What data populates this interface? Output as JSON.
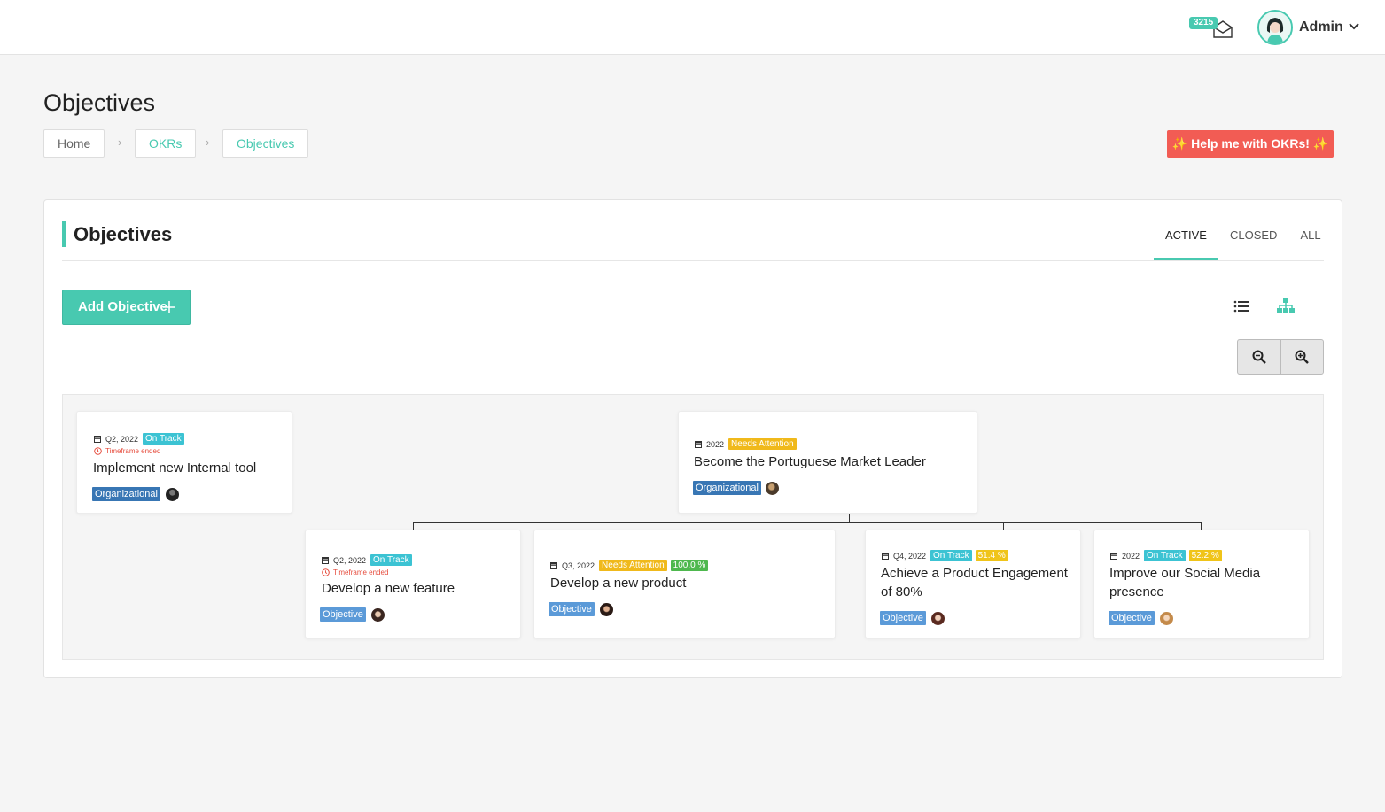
{
  "topbar": {
    "mail_count": "3215",
    "user_name": "Admin"
  },
  "header": {
    "title": "Objectives",
    "breadcrumb": [
      "Home",
      "OKRs",
      "Objectives"
    ],
    "help_button": "✨ Help me with OKRs! ✨"
  },
  "card": {
    "title": "Objectives",
    "tabs": [
      "ACTIVE",
      "CLOSED",
      "ALL"
    ],
    "active_tab": "ACTIVE",
    "add_button": "Add Objective"
  },
  "nodes": [
    {
      "period": "Q2, 2022",
      "status": "On Track",
      "timeframe": "Timeframe ended",
      "title": "Implement new Internal tool",
      "tag": "Organizational"
    },
    {
      "period": "2022",
      "status": "Needs Attention",
      "title": "Become the Portuguese Market Leader",
      "tag": "Organizational"
    },
    {
      "period": "Q2, 2022",
      "status": "On Track",
      "timeframe": "Timeframe ended",
      "title": "Develop a new feature",
      "tag": "Objective"
    },
    {
      "period": "Q3, 2022",
      "status": "Needs Attention",
      "progress": "100.0 %",
      "title": "Develop a new product",
      "tag": "Objective"
    },
    {
      "period": "Q4, 2022",
      "status": "On Track",
      "progress": "51.4 %",
      "title": "Achieve a Product Engagement of 80%",
      "tag": "Objective"
    },
    {
      "period": "2022",
      "status": "On Track",
      "progress": "52.2 %",
      "title": "Improve our Social Media presence",
      "tag": "Objective"
    }
  ],
  "colors": {
    "accent": "#48c9b0",
    "help_button": "#f25c54",
    "on_track": "#3cc3d3",
    "needs_attention": "#f0b91b",
    "organizational_tag": "#3876b4",
    "objective_tag": "#5b9ad8"
  },
  "icons": [
    "mail-icon",
    "chevron-down-icon",
    "plus-icon",
    "list-view-icon",
    "tree-view-icon",
    "zoom-out-icon",
    "zoom-in-icon",
    "calendar-icon",
    "clock-icon"
  ]
}
